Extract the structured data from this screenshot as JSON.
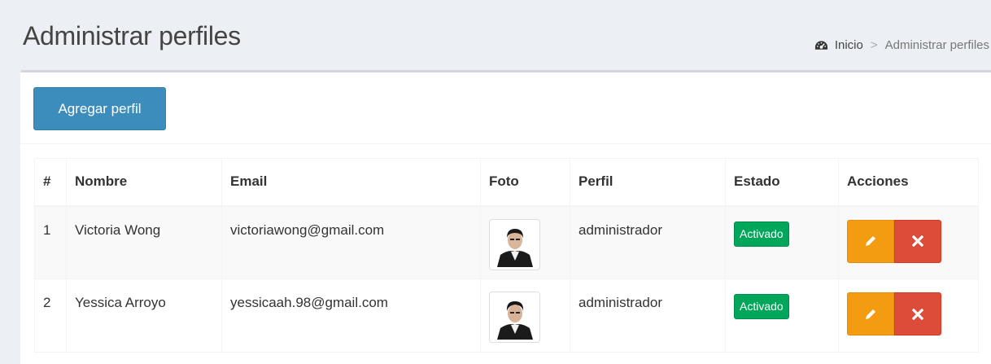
{
  "header": {
    "title": "Administrar perfiles",
    "breadcrumb": {
      "home": "Inicio",
      "current": "Administrar perfiles"
    }
  },
  "toolbar": {
    "add_label": "Agregar perfil"
  },
  "table": {
    "columns": [
      "#",
      "Nombre",
      "Email",
      "Foto",
      "Perfil",
      "Estado",
      "Acciones"
    ],
    "rows": [
      {
        "num": "1",
        "nombre": "Victoria Wong",
        "email": "victoriawong@gmail.com",
        "perfil": "administrador",
        "estado": "Activado"
      },
      {
        "num": "2",
        "nombre": "Yessica Arroyo",
        "email": "yessicaah.98@gmail.com",
        "perfil": "administrador",
        "estado": "Activado"
      }
    ]
  },
  "colors": {
    "primary": "#3c8dbc",
    "success": "#00a65a",
    "warning": "#f39c12",
    "danger": "#dd4b39",
    "background": "#ecf0f5"
  },
  "icons": {
    "breadcrumb_home": "dashboard-icon",
    "edit": "pencil-icon",
    "delete": "times-icon"
  }
}
